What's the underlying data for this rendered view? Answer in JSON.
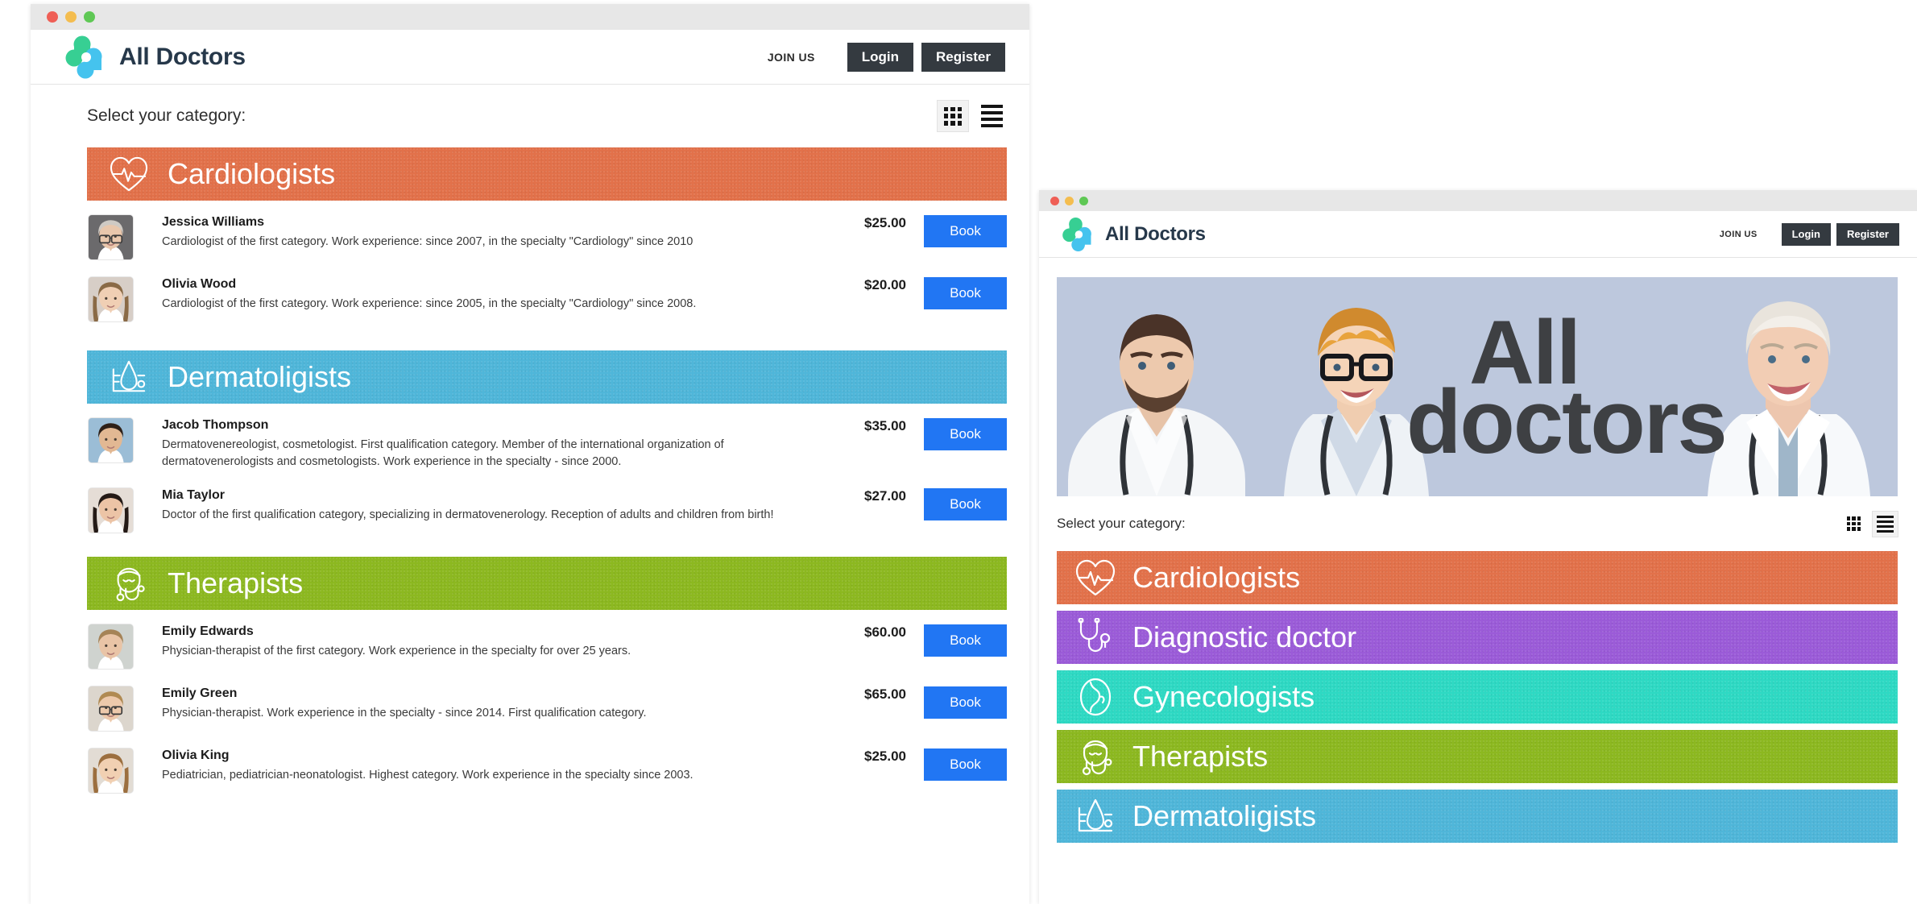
{
  "colors": {
    "cardiology": "#e2714a",
    "diagnostic": "#9b5bd8",
    "gynecology": "#2ed9c3",
    "therapy": "#8cb820",
    "dermatology": "#4fb6d9",
    "book_button": "#2176f3",
    "header_button": "#343a40",
    "brand_text": "#26384a",
    "hero_background": "#bdc8dd"
  },
  "window_left": {
    "traffic_lights": [
      "close-red",
      "minimize-yellow",
      "maximize-green"
    ],
    "header": {
      "brand_name": "All Doctors",
      "join_us_label": "JOIN US",
      "login_label": "Login",
      "register_label": "Register"
    },
    "category_bar": {
      "label": "Select your category:",
      "grid_view_icon": "grid-view-icon",
      "list_view_icon": "list-view-icon",
      "active_view": "list"
    },
    "sections": [
      {
        "title": "Cardiologists",
        "color": "#e2714a",
        "icon": "heart-pulse-icon",
        "doctors": [
          {
            "name": "Jessica Williams",
            "description": "Cardiologist of the first category. Work experience: since 2007, in the specialty \"Cardiology\" since 2010",
            "price": "$25.00",
            "book_label": "Book",
            "avatar": "avatar-jessica-williams"
          },
          {
            "name": "Olivia Wood",
            "description": "Cardiologist of the first category. Work experience: since 2005, in the specialty \"Cardiology\" since 2008.",
            "price": "$20.00",
            "book_label": "Book",
            "avatar": "avatar-olivia-wood"
          }
        ]
      },
      {
        "title": "Dermatoligists",
        "color": "#4fb6d9",
        "icon": "skin-hair-follicle-icon",
        "doctors": [
          {
            "name": "Jacob Thompson",
            "description": "Dermatovenereologist, cosmetologist. First qualification category. Member of the international organization of dermatovenerologists and cosmetologists. Work experience in the specialty - since 2000.",
            "price": "$35.00",
            "book_label": "Book",
            "avatar": "avatar-jacob-thompson"
          },
          {
            "name": "Mia Taylor",
            "description": "Doctor of the first qualification category, specializing in dermatovenerology. Reception of adults and children from birth!",
            "price": "$27.00",
            "book_label": "Book",
            "avatar": "avatar-mia-taylor"
          }
        ]
      },
      {
        "title": "Therapists",
        "color": "#8cb820",
        "icon": "doctor-stethoscope-icon",
        "doctors": [
          {
            "name": "Emily Edwards",
            "description": "Physician-therapist of the first category. Work experience in the specialty for over 25 years.",
            "price": "$60.00",
            "book_label": "Book",
            "avatar": "avatar-emily-edwards"
          },
          {
            "name": "Emily Green",
            "description": "Physician-therapist. Work experience in the specialty - since 2014. First qualification category.",
            "price": "$65.00",
            "book_label": "Book",
            "avatar": "avatar-emily-green"
          },
          {
            "name": "Olivia King",
            "description": "Pediatrician, pediatrician-neonatologist. Highest category. Work experience in the specialty since 2003.",
            "price": "$25.00",
            "book_label": "Book",
            "avatar": "avatar-olivia-king"
          }
        ]
      }
    ]
  },
  "window_right": {
    "traffic_lights": [
      "close-red",
      "minimize-yellow",
      "maximize-green"
    ],
    "header": {
      "brand_name": "All Doctors",
      "join_us_label": "JOIN US",
      "login_label": "Login",
      "register_label": "Register"
    },
    "hero": {
      "word_line_1": "All",
      "word_line_2": "doctors",
      "alt": "three doctors in white coats with stethoscopes"
    },
    "category_bar": {
      "label": "Select your category:",
      "grid_view_icon": "grid-view-icon",
      "list_view_icon": "list-view-icon",
      "active_view": "list"
    },
    "categories": [
      {
        "title": "Cardiologists",
        "color": "#e2714a",
        "icon": "heart-pulse-icon"
      },
      {
        "title": "Diagnostic doctor",
        "color": "#9b5bd8",
        "icon": "stethoscope-icon"
      },
      {
        "title": "Gynecologists",
        "color": "#2ed9c3",
        "icon": "uterus-icon"
      },
      {
        "title": "Therapists",
        "color": "#8cb820",
        "icon": "doctor-stethoscope-icon"
      },
      {
        "title": "Dermatoligists",
        "color": "#4fb6d9",
        "icon": "skin-hair-follicle-icon"
      }
    ]
  }
}
